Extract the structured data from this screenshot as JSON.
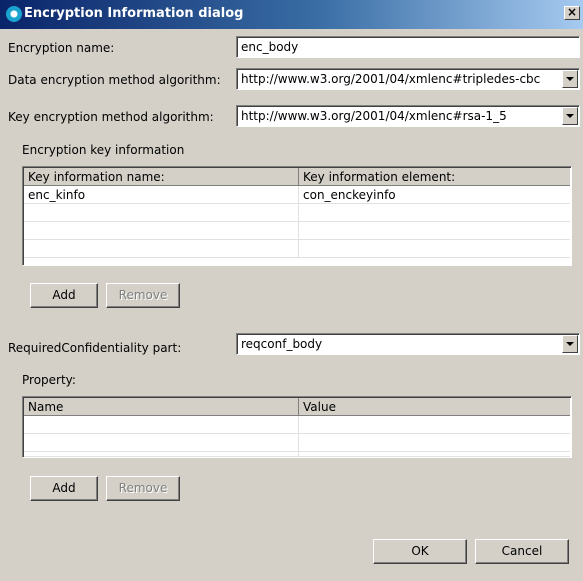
{
  "window": {
    "title": "Encryption Information dialog",
    "icon": "app-icon",
    "close_label": "×"
  },
  "form": {
    "encryption_name_label": "Encryption name:",
    "encryption_name_value": "enc_body",
    "data_method_label": "Data encryption method algorithm:",
    "data_method_value": "http://www.w3.org/2001/04/xmlenc#tripledes-cbc",
    "key_method_label": "Key encryption method algorithm:",
    "key_method_value": "http://www.w3.org/2001/04/xmlenc#rsa-1_5"
  },
  "key_info": {
    "group_label": "Encryption key information",
    "columns": [
      "Key information name:",
      "Key information element:"
    ],
    "rows": [
      [
        "enc_kinfo",
        "con_enckeyinfo"
      ],
      [
        "",
        ""
      ],
      [
        "",
        ""
      ],
      [
        "",
        ""
      ]
    ],
    "add_label": "Add",
    "remove_label": "Remove"
  },
  "required_part": {
    "label": "RequiredConfidentiality part:",
    "value": "reqconf_body"
  },
  "property": {
    "group_label": "Property:",
    "columns": [
      "Name",
      "Value"
    ],
    "rows": [
      [
        "",
        ""
      ],
      [
        "",
        ""
      ],
      [
        "",
        ""
      ]
    ],
    "add_label": "Add",
    "remove_label": "Remove"
  },
  "footer": {
    "ok_label": "OK",
    "cancel_label": "Cancel"
  }
}
